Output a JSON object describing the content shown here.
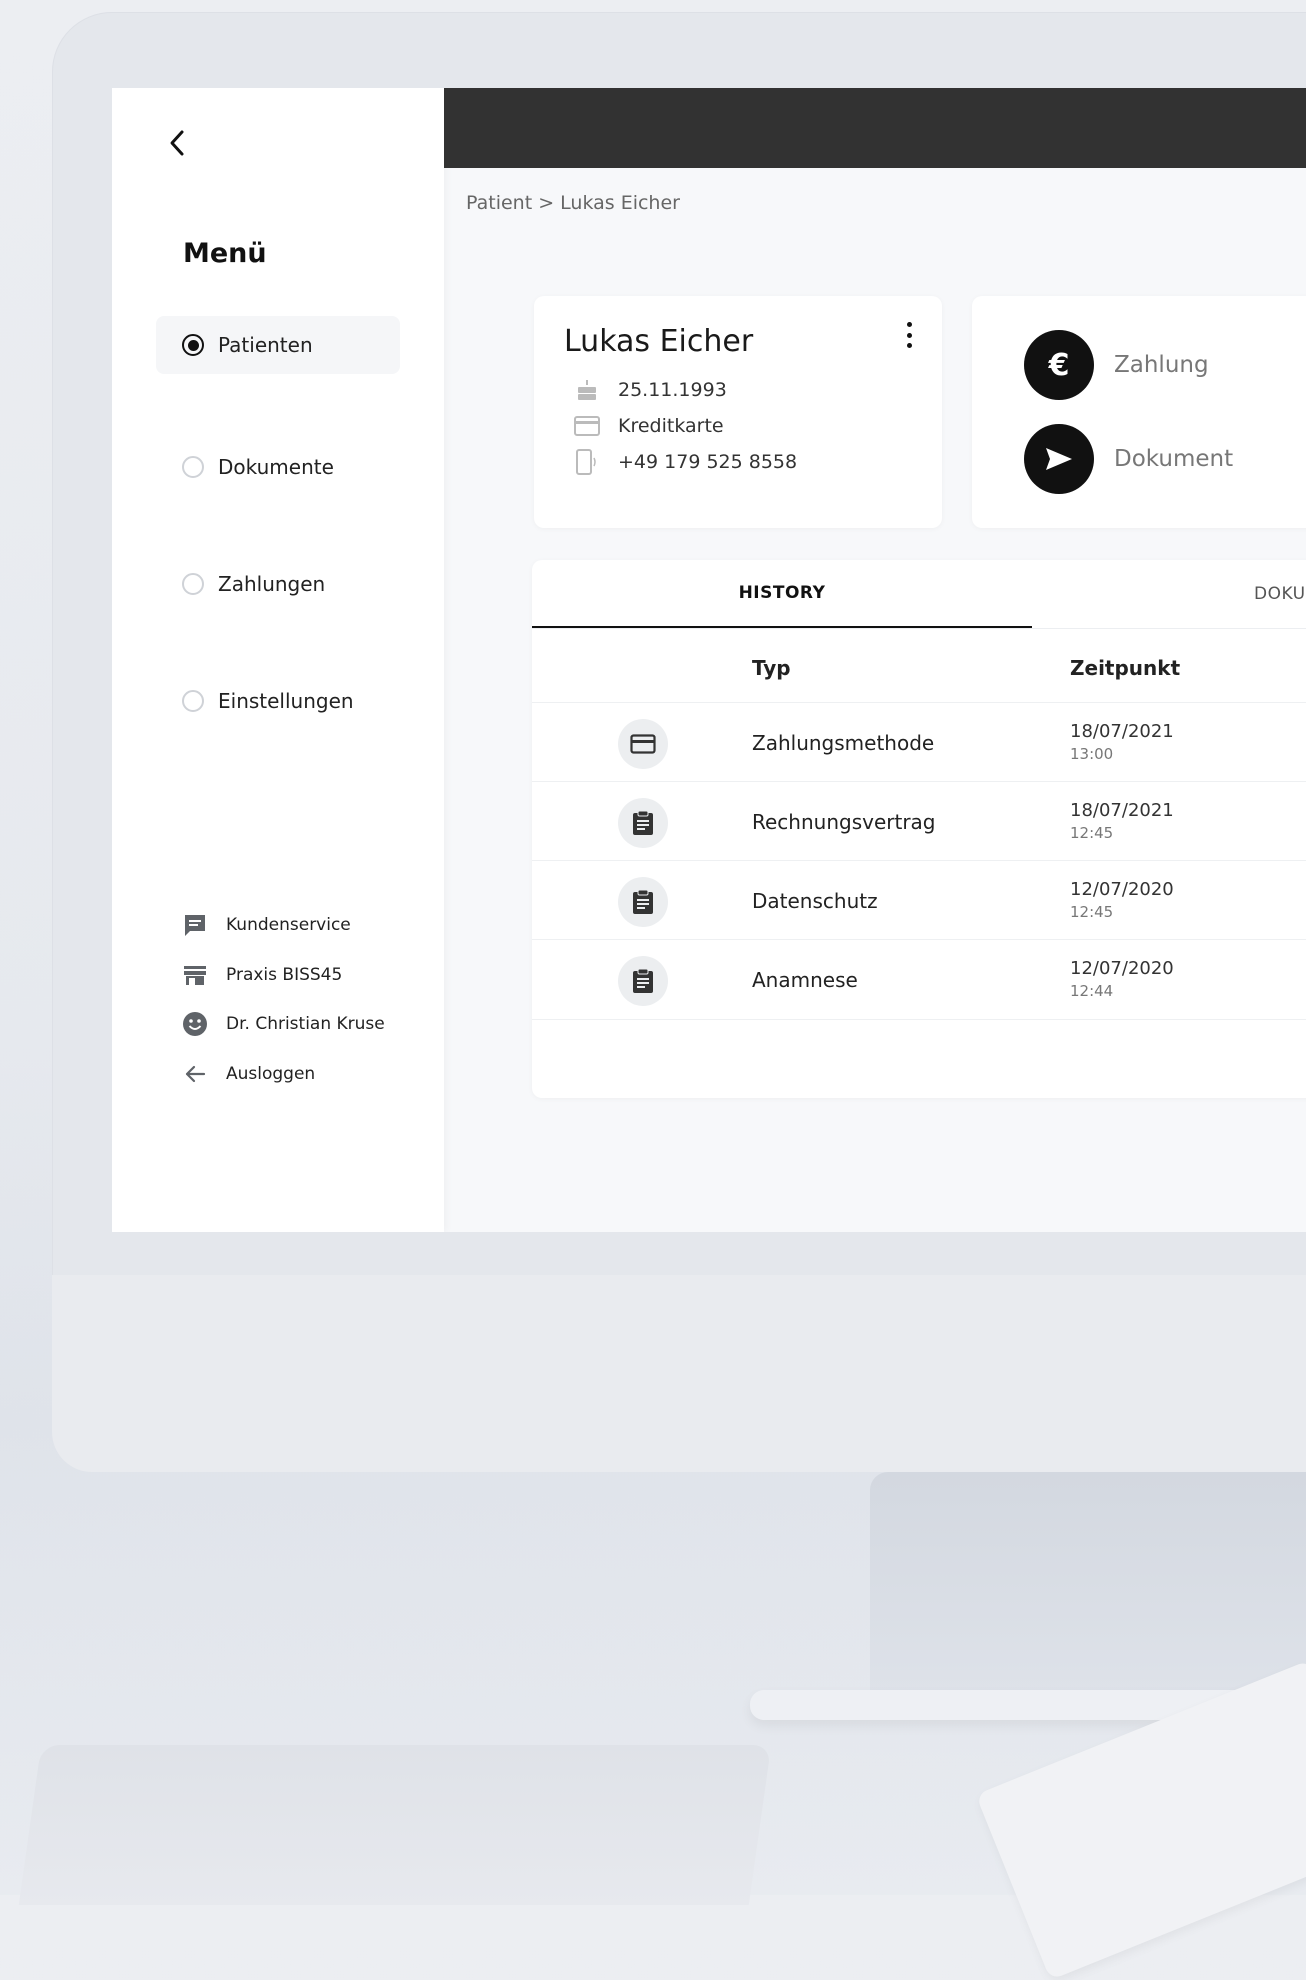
{
  "sidebar": {
    "menu_title": "Menü",
    "nav": [
      {
        "label": "Patienten",
        "active": true
      },
      {
        "label": "Dokumente",
        "active": false
      },
      {
        "label": "Zahlungen",
        "active": false
      },
      {
        "label": "Einstellungen",
        "active": false
      }
    ],
    "footer": [
      {
        "label": "Kundenservice",
        "icon": "chat-icon"
      },
      {
        "label": "Praxis BISS45",
        "icon": "store-icon"
      },
      {
        "label": "Dr. Christian Kruse",
        "icon": "face-icon"
      },
      {
        "label": "Ausloggen",
        "icon": "arrow-left-icon"
      }
    ]
  },
  "breadcrumb": "Patient > Lukas Eicher",
  "patient": {
    "name": "Lukas Eicher",
    "birthdate": "25.11.1993",
    "payment_method": "Kreditkarte",
    "phone": "+49 179 525 8558"
  },
  "actions": {
    "payment_label": "Zahlung",
    "document_label": "Dokument"
  },
  "tabs": {
    "history": "HISTORY",
    "documents": "DOKUME"
  },
  "table": {
    "col_type": "Typ",
    "col_time": "Zeitpunkt",
    "rows": [
      {
        "icon": "credit-card-icon",
        "type": "Zahlungsmethode",
        "date": "18/07/2021",
        "time": "13:00"
      },
      {
        "icon": "clipboard-icon",
        "type": "Rechnungsvertrag",
        "date": "18/07/2021",
        "time": "12:45"
      },
      {
        "icon": "clipboard-icon",
        "type": "Datenschutz",
        "date": "12/07/2020",
        "time": "12:45"
      },
      {
        "icon": "clipboard-icon",
        "type": "Anamnese",
        "date": "12/07/2020",
        "time": "12:44"
      }
    ]
  },
  "colors": {
    "topbar": "#323232",
    "accent": "#111111",
    "sidebar_bg": "#ffffff",
    "content_bg": "#f7f8fa"
  }
}
